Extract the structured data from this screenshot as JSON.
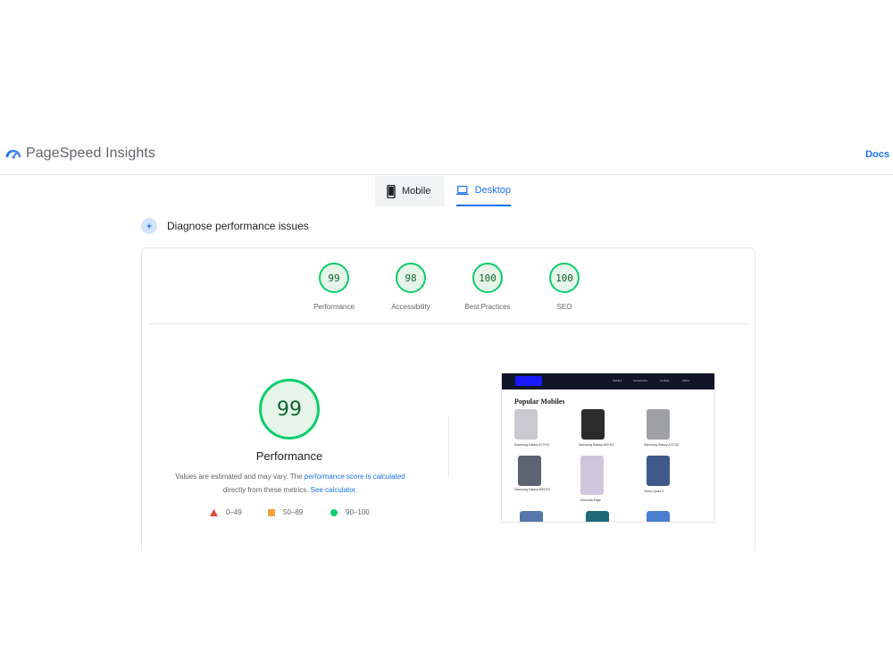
{
  "header": {
    "title": "PageSpeed Insights",
    "docs_label": "Docs"
  },
  "tabs": [
    {
      "label": "Mobile",
      "active": false
    },
    {
      "label": "Desktop",
      "active": true
    }
  ],
  "diagnose_label": "Diagnose performance issues",
  "scores": [
    {
      "value": "99",
      "label": "Performance"
    },
    {
      "value": "98",
      "label": "Accessibility"
    },
    {
      "value": "100",
      "label": "Best Practices"
    },
    {
      "value": "100",
      "label": "SEO"
    }
  ],
  "performance": {
    "score": "99",
    "title": "Performance",
    "note_1": "Values are estimated and may vary. The ",
    "note_link_1": "performance score is calculated",
    "note_2": "directly from these metrics. ",
    "note_link_2": "See calculator."
  },
  "legend": [
    {
      "range": "0–49",
      "color": "#ea4335",
      "shape": "triangle"
    },
    {
      "range": "50–89",
      "color": "#fba23b",
      "shape": "square"
    },
    {
      "range": "90–100",
      "color": "#0cce6b",
      "shape": "circle"
    }
  ],
  "screenshot": {
    "heading": "Popular Mobiles",
    "menu": [
      "Mobiles",
      "Accessories",
      "Contact",
      "About"
    ],
    "products": [
      {
        "name": "Samsung Galaxy A73 5G",
        "color": "#c9c9cf"
      },
      {
        "name": "Samsung Galaxy A53 5G",
        "color": "#2b2b2b"
      },
      {
        "name": "Samsung Galaxy A73 5G",
        "color": "#9fa0a6"
      },
      {
        "name": "Samsung Galaxy M33 5G",
        "color": "#5b6470"
      },
      {
        "name": "Motorola Edge",
        "color": "#cfc7dd"
      },
      {
        "name": "Tecno Spark 9",
        "color": "#3f5a8a"
      }
    ]
  },
  "colors": {
    "accent": "#1a73e8",
    "pass": "#0cce6b",
    "pass_text": "#0d652d"
  }
}
